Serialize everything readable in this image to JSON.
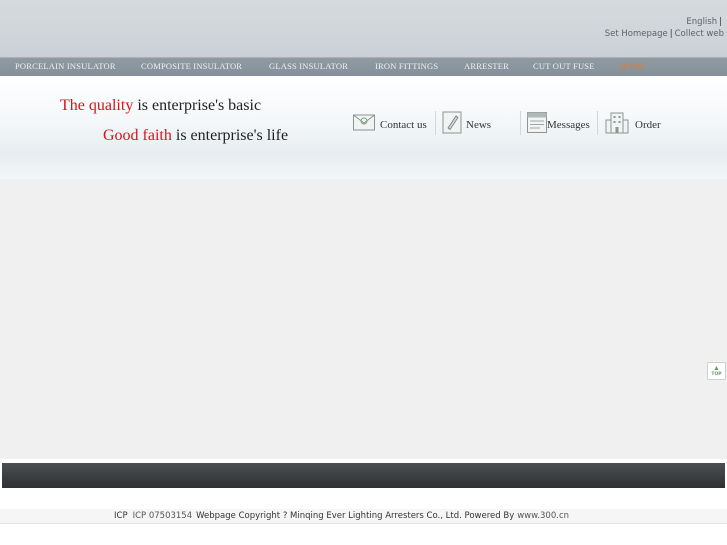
{
  "top_links": {
    "english": "English",
    "separator": "|",
    "set_homepage": "Set Homepage",
    "collect_web": "Collect web"
  },
  "nav": {
    "items": [
      {
        "label": "PORCELAIN INSULATOR"
      },
      {
        "label": "COMPOSITE INSULATOR"
      },
      {
        "label": "GLASS INSULATOR"
      },
      {
        "label": "IRON FITTINGS"
      },
      {
        "label": "ARRESTER"
      },
      {
        "label": "CUT OUT FUSE"
      },
      {
        "label": "HOME"
      }
    ],
    "active_color": "#e07a2a"
  },
  "banner": {
    "line1_red": "The quality",
    "line1_rest": " is enterprise's basic",
    "line2_red": "Good faith",
    "line2_rest": " is enterprise's life",
    "accent_color": "#d9121b"
  },
  "quick_links": {
    "contact": {
      "label": "Contact us",
      "icon": "envelope-icon"
    },
    "news": {
      "label": "News",
      "icon": "pencil-note-icon"
    },
    "messages": {
      "label": "Messages",
      "icon": "message-board-icon"
    },
    "order": {
      "label": "Order",
      "icon": "building-icon"
    }
  },
  "back_to_top": {
    "label": "TOP"
  },
  "footer": {
    "icp1": "ICP",
    "icp2": "ICP 07503154",
    "copyright": "Webpage Copyright ? Minqing Ever Lighting Arresters Co., Ltd. Powered By",
    "powered_link": "www.300.cn"
  }
}
